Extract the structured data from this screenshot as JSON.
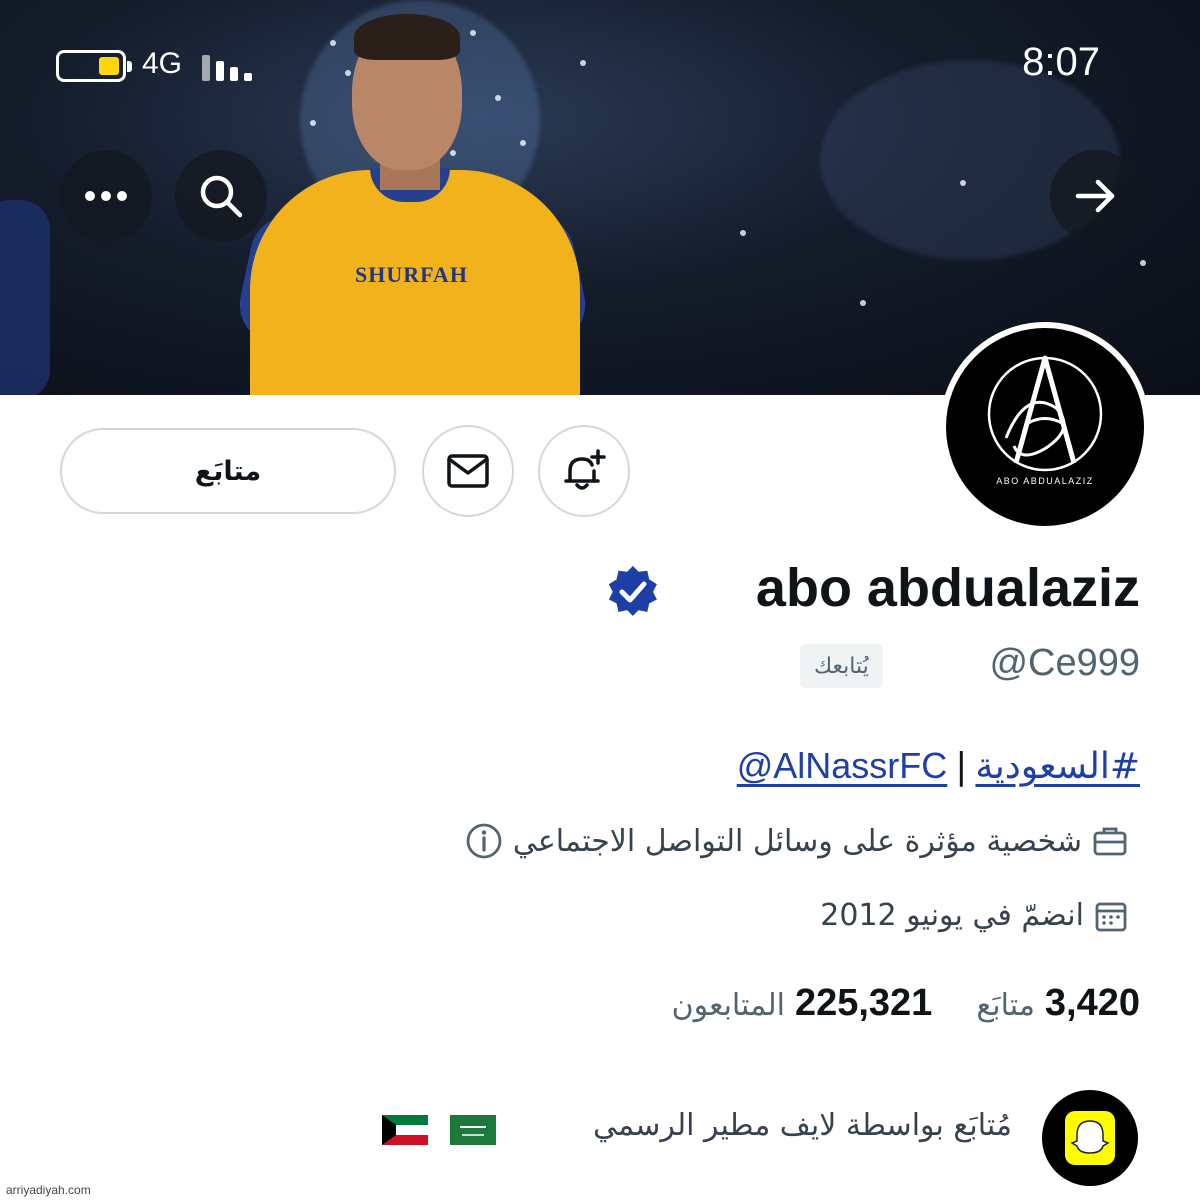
{
  "status_bar": {
    "time": "8:07",
    "network": "4G"
  },
  "profile": {
    "display_name": "abo abdualaziz",
    "handle": "@Ce999",
    "follows_you_badge": "يُتابعك",
    "avatar_caption": "ABO ABDUALAZIZ",
    "avatar_monogram": "A"
  },
  "actions": {
    "follow_label": "متابَع"
  },
  "bio": {
    "hashtag": "#السعودية",
    "separator": "|",
    "mention": "@AlNassrFC"
  },
  "meta": {
    "category": "شخصية مؤثرة على وسائل التواصل الاجتماعي",
    "joined": "انضمّ في يونيو 2012"
  },
  "stats": {
    "following_count": "3,420",
    "following_label": "متابَع",
    "followers_count": "225,321",
    "followers_label": "المتابعون"
  },
  "followed_by": {
    "text": "مُتابَع بواسطة لايف مطير الرسمي"
  },
  "banner": {
    "sponsor_text": "SHURFAH"
  },
  "watermark": "arriyadiyah.com",
  "colors": {
    "verified_blue": "#1d3fa6",
    "link_blue": "#1d3fa6",
    "jersey_yellow": "#f2b21b",
    "jersey_blue": "#26408f",
    "battery_yellow": "#ffd60a"
  }
}
